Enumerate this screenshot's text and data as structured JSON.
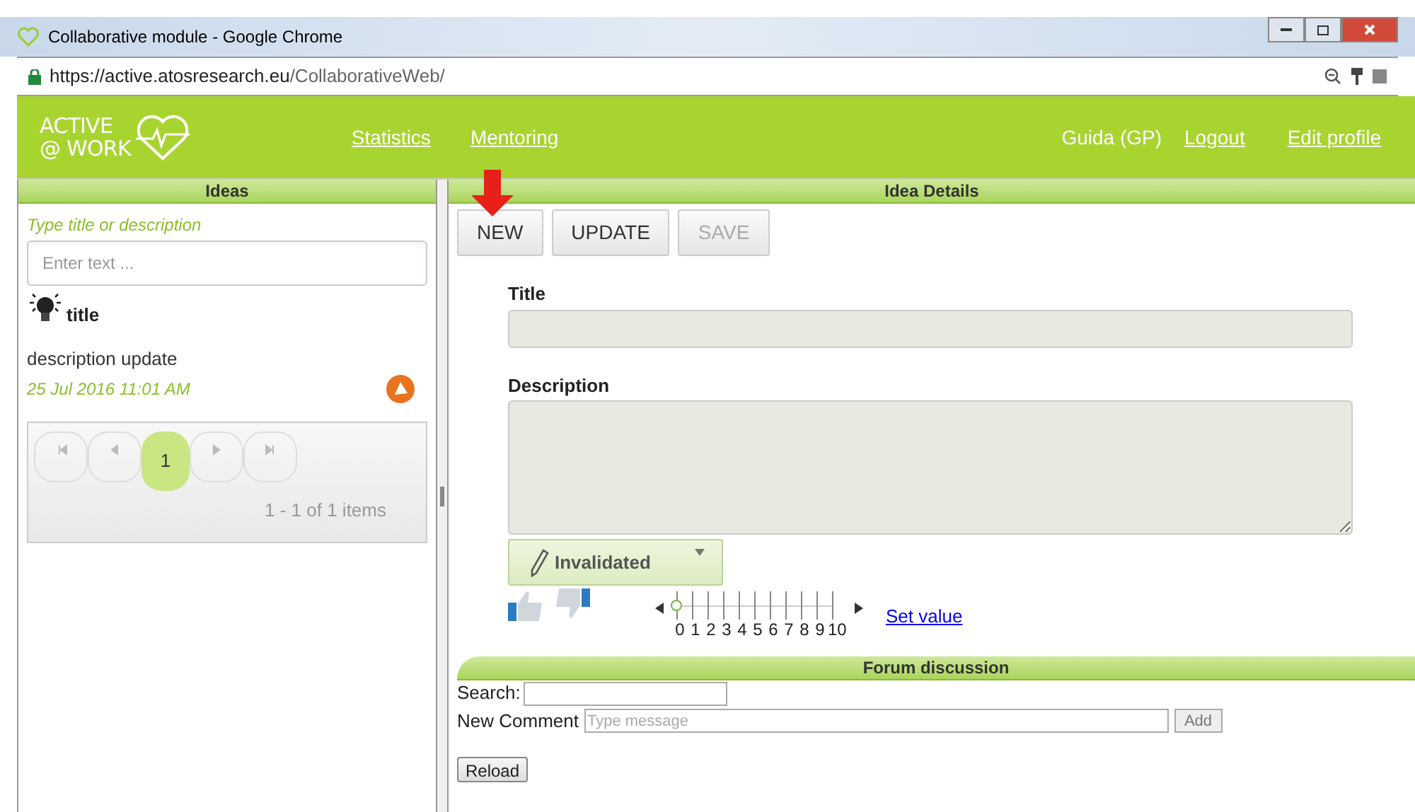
{
  "window": {
    "title": "Collaborative module - Google Chrome"
  },
  "address_bar": {
    "url_host": "https://active.atosresearch.eu",
    "url_path": "/CollaborativeWeb/"
  },
  "header": {
    "logo_lines": [
      "ACTIVE",
      "@ WORK"
    ],
    "nav": [
      "Statistics",
      "Mentoring"
    ],
    "user": "Guida (GP)",
    "links": [
      "Logout",
      "Edit profile"
    ]
  },
  "ideas_panel": {
    "title": "Ideas",
    "search_label": "Type title or description",
    "search_placeholder": "Enter text ...",
    "ideas": [
      {
        "title": "title",
        "description": "description update",
        "date": "25 Jul 2016 11:01 AM"
      }
    ],
    "pager": {
      "pages": [
        {
          "label": "1",
          "selected": true
        }
      ],
      "summary": "1 - 1 of 1 items"
    }
  },
  "details_panel": {
    "title": "Idea Details",
    "buttons": [
      {
        "label": "NEW",
        "disabled": false
      },
      {
        "label": "UPDATE",
        "disabled": false
      },
      {
        "label": "SAVE",
        "disabled": true
      }
    ],
    "fields": [
      {
        "label": "Title",
        "kind": "input"
      },
      {
        "label": "Description",
        "kind": "textarea"
      }
    ],
    "status": "Invalidated",
    "rating": {
      "level": 0,
      "ticks": [
        "0",
        "1",
        "2",
        "3",
        "4",
        "5",
        "6",
        "7",
        "8",
        "9",
        "10"
      ],
      "link": "Set value"
    }
  },
  "forum": {
    "title": "Forum discussion",
    "search_label": "Search:",
    "comment_label": "New Comment",
    "comment_placeholder": "Type message",
    "add_button": "Add",
    "reload_button": "Reload"
  }
}
